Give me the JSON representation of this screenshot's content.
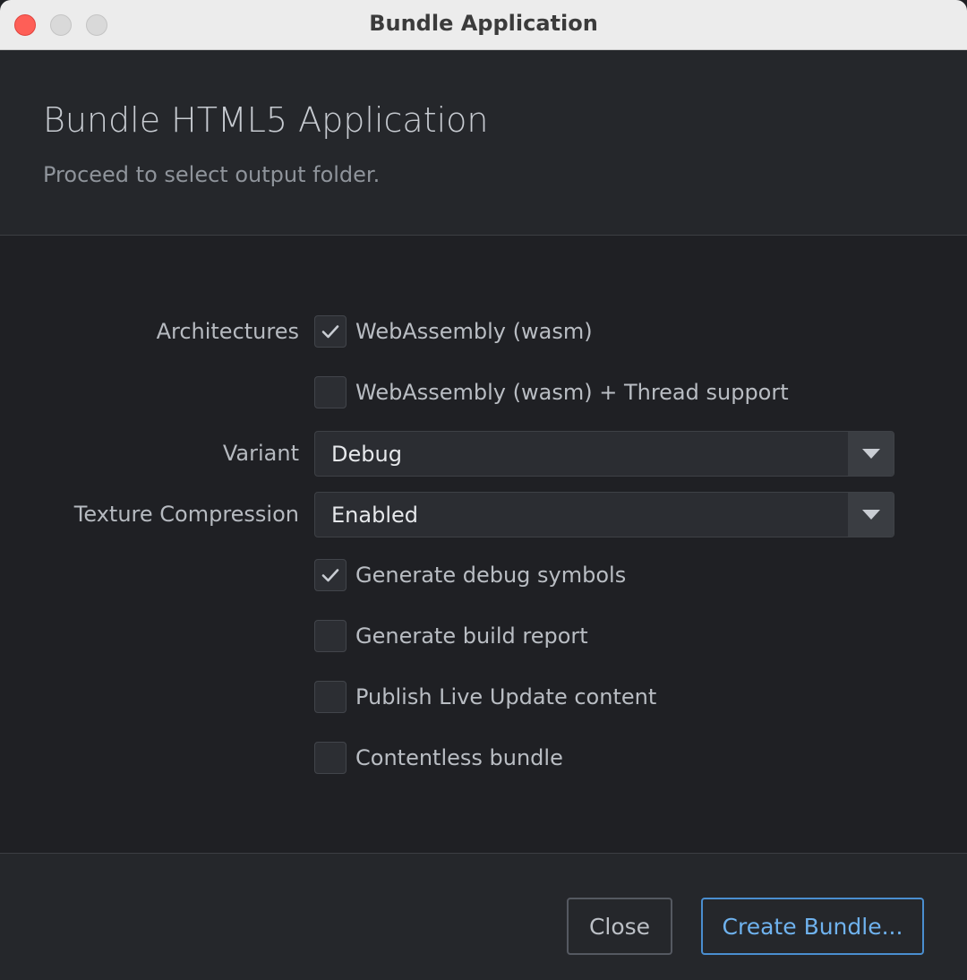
{
  "window": {
    "title": "Bundle Application"
  },
  "header": {
    "title": "Bundle HTML5 Application",
    "subtitle": "Proceed to select output folder."
  },
  "form": {
    "architectures_label": "Architectures",
    "arch_wasm": {
      "label": "WebAssembly (wasm)",
      "checked": true
    },
    "arch_wasm_threads": {
      "label": "WebAssembly (wasm) + Thread support",
      "checked": false
    },
    "variant_label": "Variant",
    "variant_value": "Debug",
    "texture_label": "Texture Compression",
    "texture_value": "Enabled",
    "debug_symbols": {
      "label": "Generate debug symbols",
      "checked": true
    },
    "build_report": {
      "label": "Generate build report",
      "checked": false
    },
    "live_update": {
      "label": "Publish Live Update content",
      "checked": false
    },
    "contentless": {
      "label": "Contentless bundle",
      "checked": false
    }
  },
  "footer": {
    "close_label": "Close",
    "create_label": "Create Bundle..."
  },
  "colors": {
    "accent": "#6fb2ee",
    "background": "#1f2024",
    "close_traffic_light": "#fe5f57"
  },
  "icons": {
    "check": "checkmark-icon",
    "dropdown": "triangle-down-icon"
  }
}
